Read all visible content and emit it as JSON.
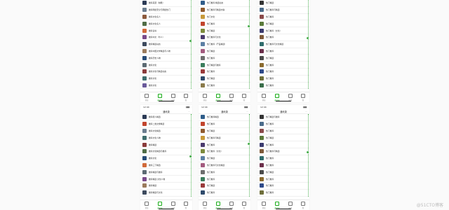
{
  "screens": [
    {
      "has_header": false,
      "rows": [
        {
          "label": "推荐来源（前瞻）",
          "color": "#2b3a55"
        },
        {
          "label": "推荐网络安全与网络热门",
          "color": "#6b7d8f"
        },
        {
          "label": "推荐文化名人",
          "color": "#8c5a3c"
        },
        {
          "label": "推荐文化名人",
          "color": "#4f6d46"
        },
        {
          "label": "推荐读书",
          "color": "#d06a3a"
        },
        {
          "label": "推荐中文（华人）",
          "color": "#7a4a8a"
        },
        {
          "label": "推荐精选动态",
          "color": "#3d4a5e"
        },
        {
          "label": "推荐中国文学精选与人物",
          "color": "#9a7b5c"
        },
        {
          "label": "推荐历史人物",
          "color": "#274c77"
        },
        {
          "label": "推荐文化",
          "color": "#5c6b73"
        },
        {
          "label": "推荐文化与精选动态",
          "color": "#8a3b3b"
        },
        {
          "label": "推荐文化",
          "color": "#3f6e6e"
        },
        {
          "label": "推荐文化",
          "color": "#6a5a9a"
        }
      ],
      "tabs": [
        "消息",
        "通讯录",
        "发现",
        "我"
      ],
      "active_tab": 1
    },
    {
      "has_header": false,
      "rows": [
        {
          "label": "热门推荐·精选动态",
          "color": "#2f5d8a"
        },
        {
          "label": "热门推荐与精选内容",
          "color": "#8f5a2e"
        },
        {
          "label": "热门文化",
          "color": "#c79a3a"
        },
        {
          "label": "热门推荐",
          "color": "#c2452d"
        },
        {
          "label": "热门精选",
          "color": "#7d8b3c"
        },
        {
          "label": "热门推荐与文化",
          "color": "#4b3b6e"
        },
        {
          "label": "热门推荐（产品精选）",
          "color": "#5b7fa3"
        },
        {
          "label": "热门精选",
          "color": "#a35b7f"
        },
        {
          "label": "热门推荐",
          "color": "#6e6e6e"
        },
        {
          "label": "热门精选与推荐",
          "color": "#3a7d5c"
        },
        {
          "label": "热门推荐",
          "color": "#9a3a3a"
        },
        {
          "label": "热门精选",
          "color": "#2e4a6b"
        },
        {
          "label": "热门推荐",
          "color": "#8a7a4a"
        }
      ],
      "tabs": [
        "消息",
        "通讯录",
        "发现",
        "我"
      ],
      "active_tab": 1
    },
    {
      "has_header": false,
      "rows": [
        {
          "label": "热门精选",
          "color": "#333333"
        },
        {
          "label": "热门推荐与精选",
          "color": "#4a6b8a"
        },
        {
          "label": "热门推荐",
          "color": "#8a4a4a"
        },
        {
          "label": "热门精选",
          "color": "#5a7a3a"
        },
        {
          "label": "热门推荐（文化）",
          "color": "#3a3a6e"
        },
        {
          "label": "热门推荐",
          "color": "#7e5a3a"
        },
        {
          "label": "热门推荐与文化精选",
          "color": "#2e6b6b"
        },
        {
          "label": "热门推荐",
          "color": "#6b2e4a"
        },
        {
          "label": "热门精选",
          "color": "#4a4a4a"
        },
        {
          "label": "热门推荐",
          "color": "#8a6a2e"
        },
        {
          "label": "热门推荐",
          "color": "#2e4a8a"
        },
        {
          "label": "热门推荐",
          "color": "#6e6e3a"
        },
        {
          "label": "热门推荐",
          "color": "#3a6e4a"
        }
      ],
      "tabs": [
        "消息",
        "通讯录",
        "发现",
        "我"
      ],
      "active_tab": 1
    },
    {
      "has_header": true,
      "time": "12:44",
      "title": "通讯录",
      "rows": [
        {
          "label": "推荐能人精选",
          "color": "#2b3a55"
        },
        {
          "label": "推荐二维文章精选",
          "color": "#c2452d"
        },
        {
          "label": "推荐文化精选",
          "color": "#6b7d8f"
        },
        {
          "label": "推荐文化人物",
          "color": "#3f6e6e"
        },
        {
          "label": "推荐精选",
          "color": "#8a3b3b"
        },
        {
          "label": "推荐文化精选与推荐",
          "color": "#4f6d46"
        },
        {
          "label": "推荐文化",
          "color": "#274c77"
        },
        {
          "label": "推荐三下精选",
          "color": "#d06a3a"
        },
        {
          "label": "推荐精选与推荐",
          "color": "#5c6b73"
        },
        {
          "label": "推荐精选·文化人物",
          "color": "#7a4a8a"
        },
        {
          "label": "推荐精选",
          "color": "#9a7b5c"
        },
        {
          "label": "推荐精选与文化",
          "color": "#3d4a5e"
        }
      ],
      "tabs": [
        "消息",
        "通讯录",
        "发现",
        "我"
      ],
      "active_tab": 1
    },
    {
      "has_header": true,
      "time": "12:44",
      "title": "通讯录",
      "rows": [
        {
          "label": "热门推荐精选",
          "color": "#2f5d8a"
        },
        {
          "label": "热门推荐",
          "color": "#c2452d"
        },
        {
          "label": "热门精选",
          "color": "#8f5a2e"
        },
        {
          "label": "热门推荐与精选",
          "color": "#c79a3a"
        },
        {
          "label": "热门推荐",
          "color": "#4b3b6e"
        },
        {
          "label": "热门推荐（文化）",
          "color": "#7d8b3c"
        },
        {
          "label": "热门精选",
          "color": "#5b7fa3"
        },
        {
          "label": "热门推荐与文化精选",
          "color": "#a35b7f"
        },
        {
          "label": "热门推荐",
          "color": "#6e6e6e"
        },
        {
          "label": "热门推荐",
          "color": "#3a7d5c"
        },
        {
          "label": "热门精选",
          "color": "#9a3a3a"
        },
        {
          "label": "热门推荐",
          "color": "#2e4a6b"
        }
      ],
      "tabs": [
        "消息",
        "通讯录",
        "发现",
        "我"
      ],
      "active_tab": 1
    },
    {
      "has_header": true,
      "time": "12:44",
      "title": "通讯录",
      "rows": [
        {
          "label": "热门精选与推荐",
          "color": "#333333"
        },
        {
          "label": "热门推荐",
          "color": "#4a6b8a"
        },
        {
          "label": "热门推荐",
          "color": "#8a4a4a"
        },
        {
          "label": "热门精选",
          "color": "#5a7a3a"
        },
        {
          "label": "热门推荐",
          "color": "#3a3a6e"
        },
        {
          "label": "热门推荐与精选",
          "color": "#7e5a3a"
        },
        {
          "label": "热门推荐",
          "color": "#2e6b6b"
        },
        {
          "label": "热门推荐",
          "color": "#6b2e4a"
        },
        {
          "label": "热门精选",
          "color": "#4a4a4a"
        },
        {
          "label": "热门推荐",
          "color": "#8a6a2e"
        },
        {
          "label": "热门推荐",
          "color": "#2e4a8a"
        },
        {
          "label": "热门推荐",
          "color": "#6e6e3a"
        }
      ],
      "tabs": [
        "消息",
        "通讯录",
        "发现",
        "我"
      ],
      "active_tab": 1
    }
  ],
  "watermark": "@51CTO博客",
  "accent_color": "#1aad19",
  "rail_color": "#4caf50"
}
